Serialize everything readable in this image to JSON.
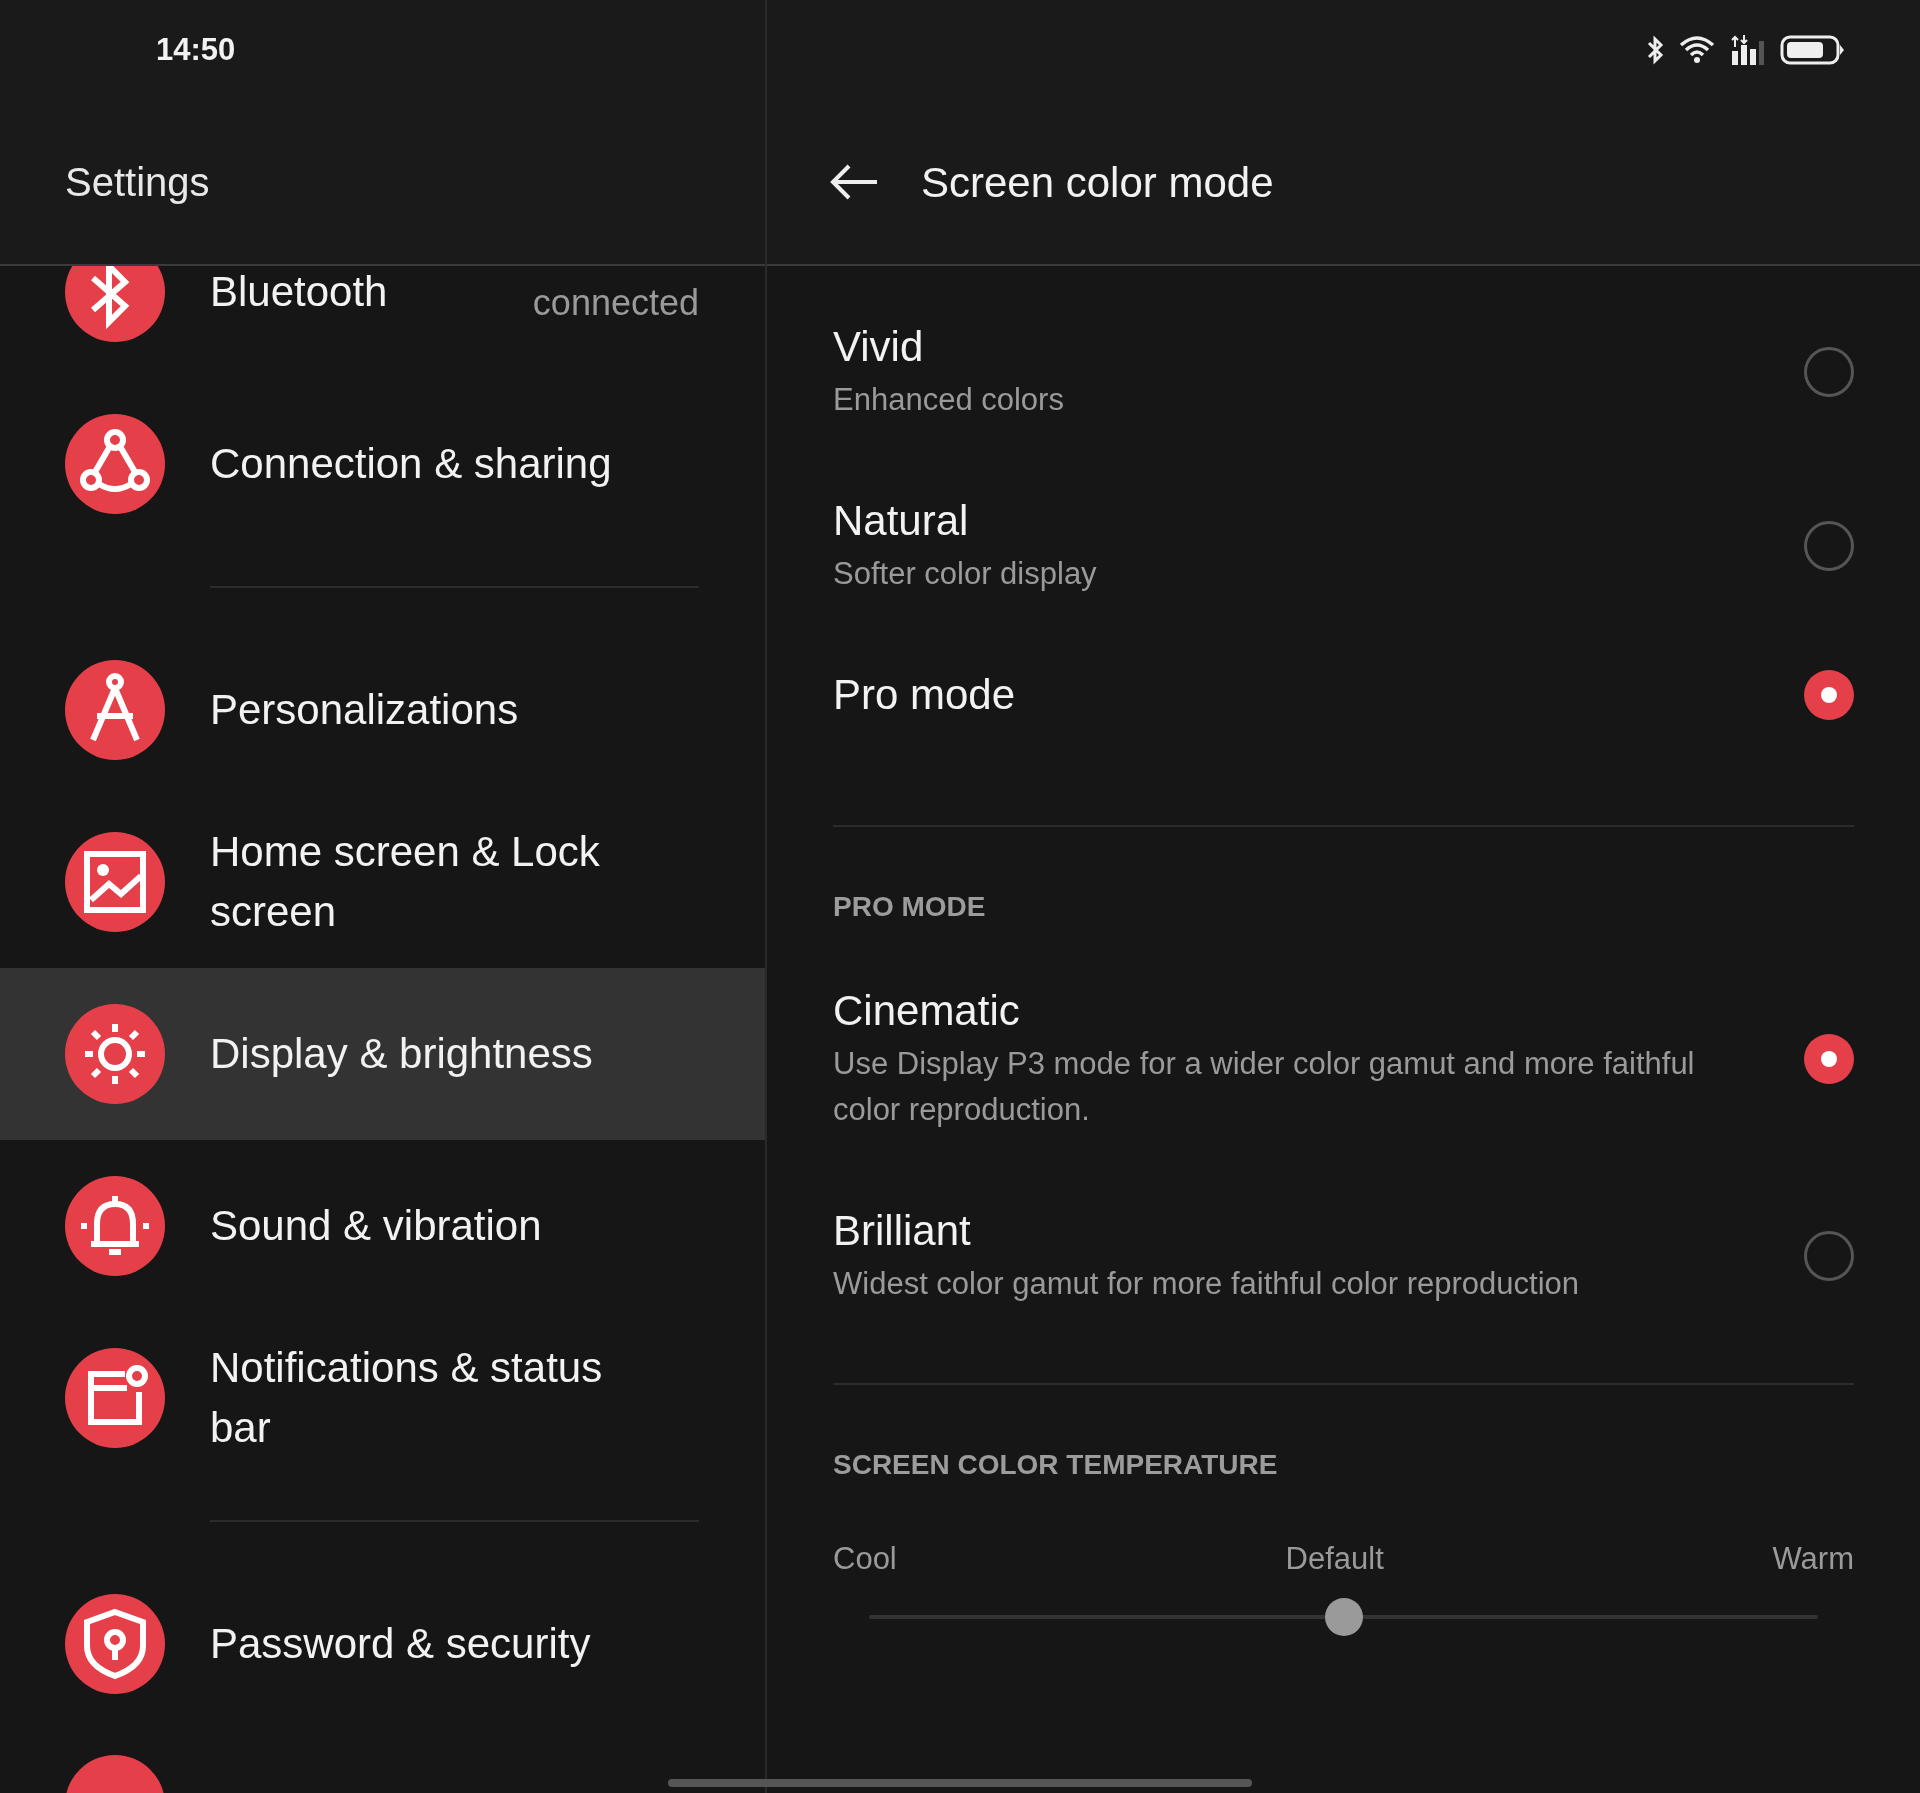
{
  "status_bar": {
    "time": "14:50"
  },
  "sidebar": {
    "title": "Settings",
    "groups": [
      [
        {
          "label": "Bluetooth",
          "status": "connected",
          "selected": false
        },
        {
          "label": "Connection & sharing",
          "selected": false
        }
      ],
      [
        {
          "label": "Personalizations",
          "selected": false
        },
        {
          "label": "Home screen & Lock screen",
          "selected": false
        },
        {
          "label": "Display & brightness",
          "selected": true
        },
        {
          "label": "Sound & vibration",
          "selected": false
        },
        {
          "label": "Notifications & status bar",
          "selected": false
        }
      ],
      [
        {
          "label": "Password & security",
          "selected": false
        },
        {
          "selected": false
        }
      ]
    ]
  },
  "detail": {
    "title": "Screen color mode",
    "sections": [
      {
        "options": [
          {
            "title": "Vivid",
            "subtitle": "Enhanced colors",
            "selected": false
          },
          {
            "title": "Natural",
            "subtitle": "Softer color display",
            "selected": false
          },
          {
            "title": "Pro mode",
            "selected": true
          }
        ]
      },
      {
        "header": "PRO MODE",
        "options": [
          {
            "title": "Cinematic",
            "subtitle": "Use Display P3 mode for a wider color gamut and more faithful color reproduction.",
            "selected": true
          },
          {
            "title": "Brilliant",
            "subtitle": "Widest color gamut for more faithful color reproduction",
            "selected": false
          }
        ]
      },
      {
        "header": "SCREEN COLOR TEMPERATURE",
        "slider": {
          "labels": [
            "Cool",
            "Default",
            "Warm"
          ],
          "level": 0.5
        }
      }
    ]
  }
}
